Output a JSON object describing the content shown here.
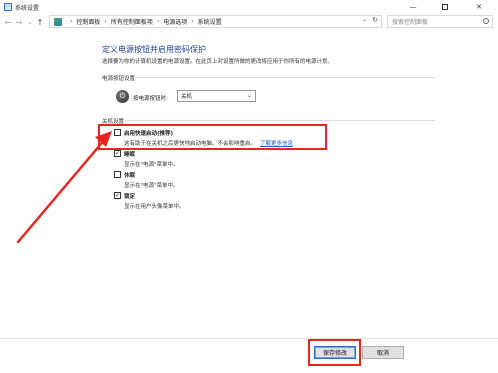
{
  "window": {
    "title": "系统设置",
    "minimize": "—",
    "close": "✕"
  },
  "address": {
    "back": "←",
    "forward": "→",
    "history": "⌄",
    "up": "↑",
    "crumbs": [
      "控制面板",
      "所有控制面板项",
      "电源选项",
      "系统设置"
    ],
    "separator": "›",
    "dropdown": "⌄",
    "refresh": "↻",
    "search_placeholder": "搜索控制面板"
  },
  "main": {
    "title": "定义电源按钮并启用密码保护",
    "description": "选择要为你的计算机设置的电源设置。在此页上对设置所做的更改将应用于你所有的电源计划。",
    "power_section": {
      "heading": "电源按钮设置",
      "label": "按电源按钮时:",
      "selected": "关机",
      "chevron": "⌄"
    },
    "shutdown_section": {
      "heading": "关机设置",
      "options": [
        {
          "label": "启用快速启动(推荐)",
          "desc": "这有助于在关机之后更快地启动电脑。不会影响重启。",
          "link": "了解更多信息",
          "checked": false,
          "mark": ""
        },
        {
          "label": "睡眠",
          "desc": "显示在\"电源\"菜单中。",
          "checked": true,
          "mark": "✓"
        },
        {
          "label": "休眠",
          "desc": "显示在\"电源\"菜单中。",
          "checked": false,
          "mark": ""
        },
        {
          "label": "锁定",
          "desc": "显示在用户头像菜单中。",
          "checked": true,
          "mark": "✓"
        }
      ]
    }
  },
  "footer": {
    "save_label": "保存修改",
    "cancel_label": "取消"
  },
  "colors": {
    "title_blue": "#1e3f8f",
    "annotation_red": "#e8251f",
    "link_blue": "#1a5fc6"
  }
}
